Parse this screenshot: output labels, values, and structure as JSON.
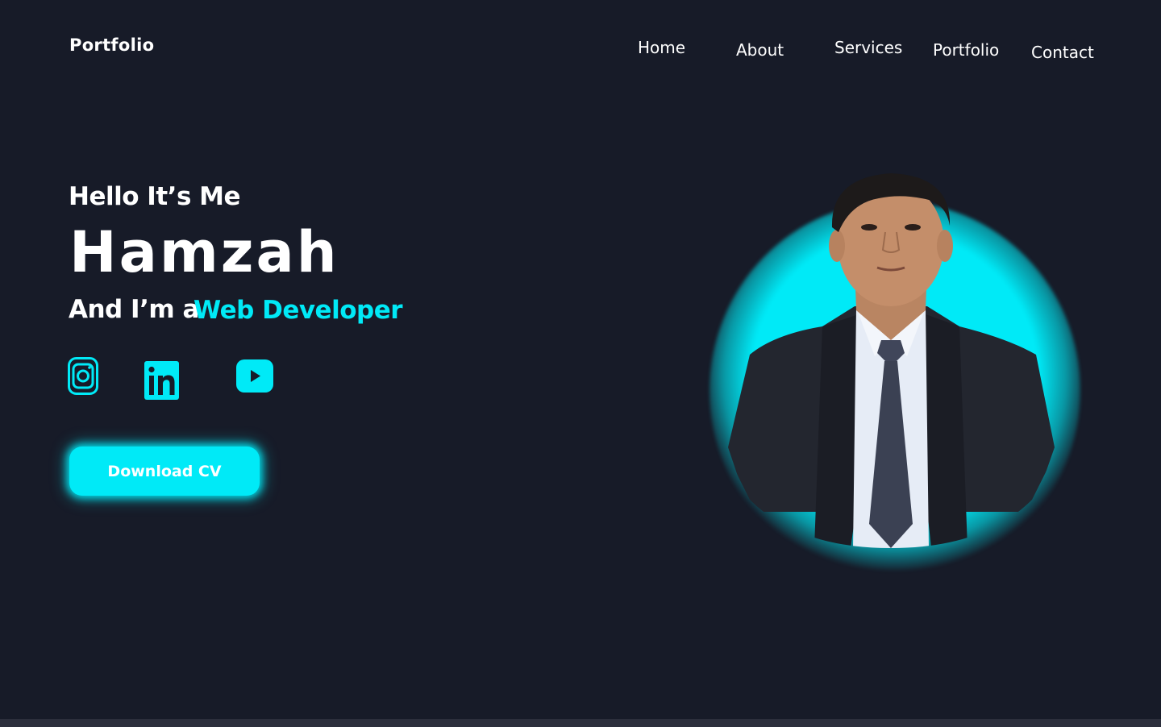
{
  "header": {
    "logo": "Portfolio",
    "nav": {
      "home": "Home",
      "about": "About",
      "services": "Services",
      "portfolio": "Portfolio",
      "contact": "Contact"
    }
  },
  "hero": {
    "greeting": "Hello It’s Me",
    "name": "Hamzah",
    "role_prefix": "And I’m a",
    "role": "Web Developer",
    "cta": "Download CV",
    "social_icons": [
      "instagram-icon",
      "linkedin-icon",
      "youtube-icon"
    ]
  },
  "colors": {
    "background": "#171b28",
    "accent": "#00eaf7",
    "text": "#ffffff"
  }
}
